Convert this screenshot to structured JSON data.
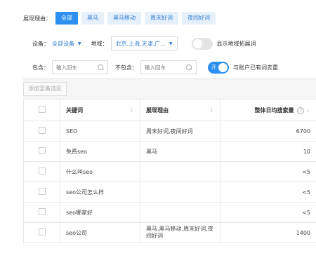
{
  "filters": {
    "label": "展现理由：",
    "tags": [
      "全部",
      "黑马",
      "黑马移动",
      "周末好词",
      "夜间好词"
    ]
  },
  "device": {
    "label": "设备：",
    "value": "全部设备"
  },
  "region": {
    "label": "地域：",
    "value": "北京,上海,天津,广..."
  },
  "region_expand": {
    "label": "显示地域拓展词",
    "state": false
  },
  "include": {
    "label": "包含：",
    "placeholder": "输入回车"
  },
  "exclude": {
    "label": "不包含：",
    "placeholder": "输入回车"
  },
  "dedupe": {
    "toggle_text": "开",
    "label": "与账户已有词去重",
    "state": true
  },
  "toolbar": {
    "add_label": "添加至备选区"
  },
  "table": {
    "columns": [
      "关键词",
      "展现理由",
      "整体日均搜索量"
    ],
    "rows": [
      {
        "keyword": "SEO",
        "reason": "周末好词,夜间好词",
        "volume": "6700"
      },
      {
        "keyword": "免费seo",
        "reason": "黑马",
        "volume": "10"
      },
      {
        "keyword": "什么叫seo",
        "reason": "",
        "volume": "<5"
      },
      {
        "keyword": "seo公司怎么样",
        "reason": "",
        "volume": "<5"
      },
      {
        "keyword": "seo哪家好",
        "reason": "",
        "volume": "<5"
      },
      {
        "keyword": "seo公司",
        "reason": "黑马,黑马移动,周末好词,夜间好词",
        "volume": "1400"
      }
    ]
  },
  "colors": {
    "accent": "#2d8ff0",
    "tag_bg": "#e6f0fb",
    "link": "#2f7fd4"
  }
}
